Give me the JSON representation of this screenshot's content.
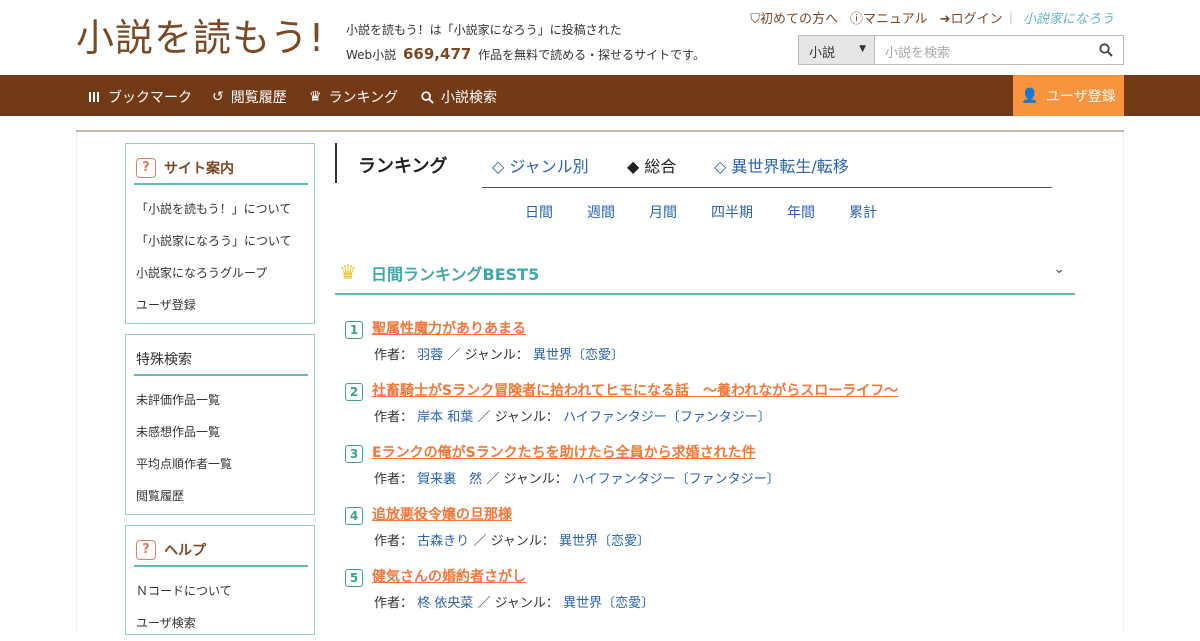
{
  "header": {
    "logo_main": "小説を読もう!",
    "tagline_line1": "小説を読もう！は「小説家になろう」に投稿された",
    "tagline_prefix": "Web小説",
    "work_count": "669,477",
    "tagline_suffix": "作品を無料で読める・探せるサイトです。",
    "links": [
      {
        "label": "初めての方へ",
        "icon": "shield-icon"
      },
      {
        "label": "マニュアル",
        "icon": "question-circle-icon"
      },
      {
        "label": "ログイン",
        "icon": "login-icon"
      }
    ],
    "narou_link": "小説家になろう",
    "search": {
      "select_value": "小説",
      "placeholder": "小説を検索"
    }
  },
  "nav": {
    "items": [
      {
        "label": "ブックマーク",
        "icon": "bookmark-icon"
      },
      {
        "label": "閲覧履歴",
        "icon": "history-icon"
      },
      {
        "label": "ランキング",
        "icon": "crown-icon"
      },
      {
        "label": "小説検索",
        "icon": "search-icon"
      }
    ],
    "register": "ユーザ登録"
  },
  "sidebar": {
    "site_guide": {
      "title": "サイト案内",
      "items": [
        "「小説を読もう！」について",
        "「小説家になろう」について",
        "小説家になろうグループ",
        "ユーザ登録"
      ]
    },
    "special_search": {
      "title": "特殊検索",
      "items": [
        "未評価作品一覧",
        "未感想作品一覧",
        "平均点順作者一覧",
        "閲覧履歴"
      ]
    },
    "help": {
      "title": "ヘルプ",
      "items": [
        "Ｎコードについて",
        "ユーザ検索"
      ]
    }
  },
  "ranking": {
    "title": "ランキング",
    "tabs": [
      {
        "label": "◇ ジャンル別",
        "active": false
      },
      {
        "label": "◆ 総合",
        "active": true
      },
      {
        "label": "◇ 異世界転生/転移",
        "active": false
      }
    ],
    "periods": [
      "日間",
      "週間",
      "月間",
      "四半期",
      "年間",
      "累計"
    ],
    "best_title": "日間ランキングBEST5",
    "author_label": "作者：",
    "genre_label": "／ ジャンル：",
    "entries": [
      {
        "rank": "1",
        "title": "聖属性魔力がありあまる",
        "author": "羽蓉",
        "genre": "異世界〔恋愛〕"
      },
      {
        "rank": "2",
        "title": "社畜騎士がSランク冒険者に拾われてヒモになる話　～養われながらスローライフ～",
        "author": "岸本 和葉",
        "genre": "ハイファンタジー〔ファンタジー〕"
      },
      {
        "rank": "3",
        "title": "Eランクの俺がSランクたちを助けたら全員から求婚された件",
        "author": "賀来裏　然",
        "genre": "ハイファンタジー〔ファンタジー〕"
      },
      {
        "rank": "4",
        "title": "追放悪役令嬢の旦那様",
        "author": "古森きり",
        "genre": "異世界〔恋愛〕"
      },
      {
        "rank": "5",
        "title": "健気さんの婚約者さがし",
        "author": "柊 依央菜",
        "genre": "異世界〔恋愛〕"
      }
    ]
  },
  "colors": {
    "brand_brown": "#733a18",
    "accent_orange": "#f7943d",
    "teal": "#5cbdbb",
    "link_blue": "#2863b4"
  }
}
